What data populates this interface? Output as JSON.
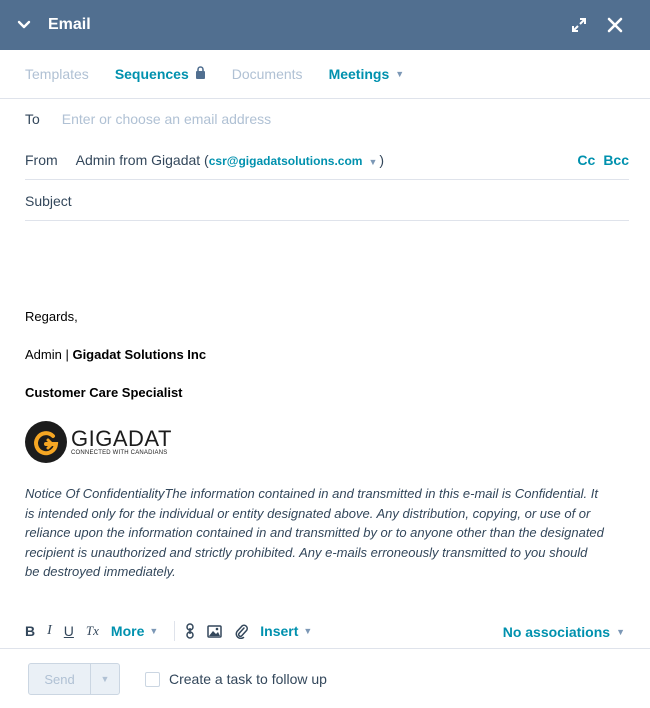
{
  "header": {
    "title": "Email",
    "icons": [
      "chevron-down-icon",
      "expand-icon",
      "close-icon"
    ]
  },
  "tabs": [
    {
      "label": "Templates",
      "state": "disabled"
    },
    {
      "label": "Sequences",
      "state": "active"
    },
    {
      "label": "Documents",
      "state": "disabled"
    },
    {
      "label": "Meetings",
      "state": "link"
    }
  ],
  "to": {
    "label": "To",
    "placeholder": "Enter or choose an email address"
  },
  "from": {
    "label": "From",
    "name": "Admin from Gigadat (",
    "email": "csr@gigadatsolutions.com",
    "close_paren": ")",
    "cc": "Cc",
    "bcc": "Bcc"
  },
  "subject": {
    "label": "Subject"
  },
  "body": {
    "regards": "Regards,",
    "sig_name": "Admin | ",
    "sig_company": "Gigadat Solutions Inc",
    "sig_title": "Customer Care Specialist",
    "logo_text": "GIGADAT",
    "logo_tagline": "CONNECTED WITH CANADIANS",
    "notice": "Notice Of ConfidentialityThe information contained in and transmitted in this e-mail is Confidential. It is intended only for the individual or entity designated above. Any distribution, copying, or use of or reliance upon the information contained in and transmitted by or to anyone other than the designated recipient is unauthorized and strictly prohibited. Any e-mails erroneously transmitted to you should be destroyed immediately."
  },
  "toolbar": {
    "bold": "B",
    "italic": "I",
    "underline": "U",
    "clear": "Tx",
    "more": "More",
    "insert": "Insert",
    "associations": "No associations"
  },
  "footer": {
    "send": "Send",
    "task": "Create a task to follow up"
  },
  "colors": {
    "header_bg": "#516f90",
    "accent": "#0091ae",
    "disabled": "#b0c1d4",
    "text": "#33475b",
    "logo_orange": "#f5a623"
  }
}
